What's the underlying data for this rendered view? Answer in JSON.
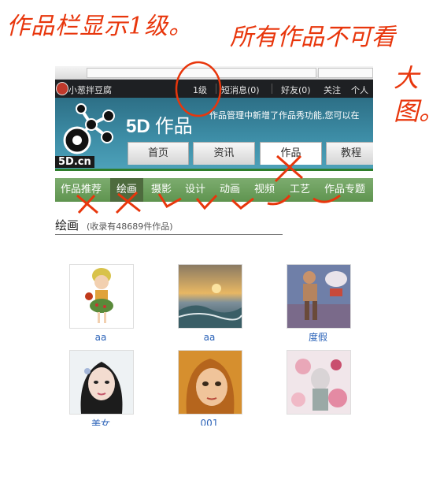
{
  "annotations": {
    "left_note": "作品栏显示1级。",
    "right_note": "所有作品不可看",
    "vertical_note": "大图。"
  },
  "topbar": {
    "username": "小葱拌豆腐",
    "level": "1级",
    "messages": "短消息(0)",
    "friends": "好友(0)",
    "follow": "关注",
    "personal": "个人"
  },
  "header": {
    "logo_text": "5D.cn",
    "brand_main": "5D",
    "brand_sub": "作品",
    "notice": "作品管理中新增了作品秀功能,您可以在"
  },
  "tabs": [
    {
      "label": "首页"
    },
    {
      "label": "资讯"
    },
    {
      "label": "作品"
    },
    {
      "label": "教程"
    }
  ],
  "subnav": [
    {
      "label": "作品推荐"
    },
    {
      "label": "绘画"
    },
    {
      "label": "摄影"
    },
    {
      "label": "设计"
    },
    {
      "label": "动画"
    },
    {
      "label": "视频"
    },
    {
      "label": "工艺"
    },
    {
      "label": "作品专题"
    }
  ],
  "section": {
    "title": "绘画",
    "count": "(收录有48689件作品)"
  },
  "works": [
    {
      "caption": "aa"
    },
    {
      "caption": "aa"
    },
    {
      "caption": "度假"
    },
    {
      "caption": "美女"
    },
    {
      "caption": "001"
    },
    {
      "caption": ""
    }
  ],
  "colors": {
    "annotation": "#e8360c",
    "header": "#3d8da6",
    "subnav": "#6a9d5a",
    "link": "#2a62b8"
  }
}
